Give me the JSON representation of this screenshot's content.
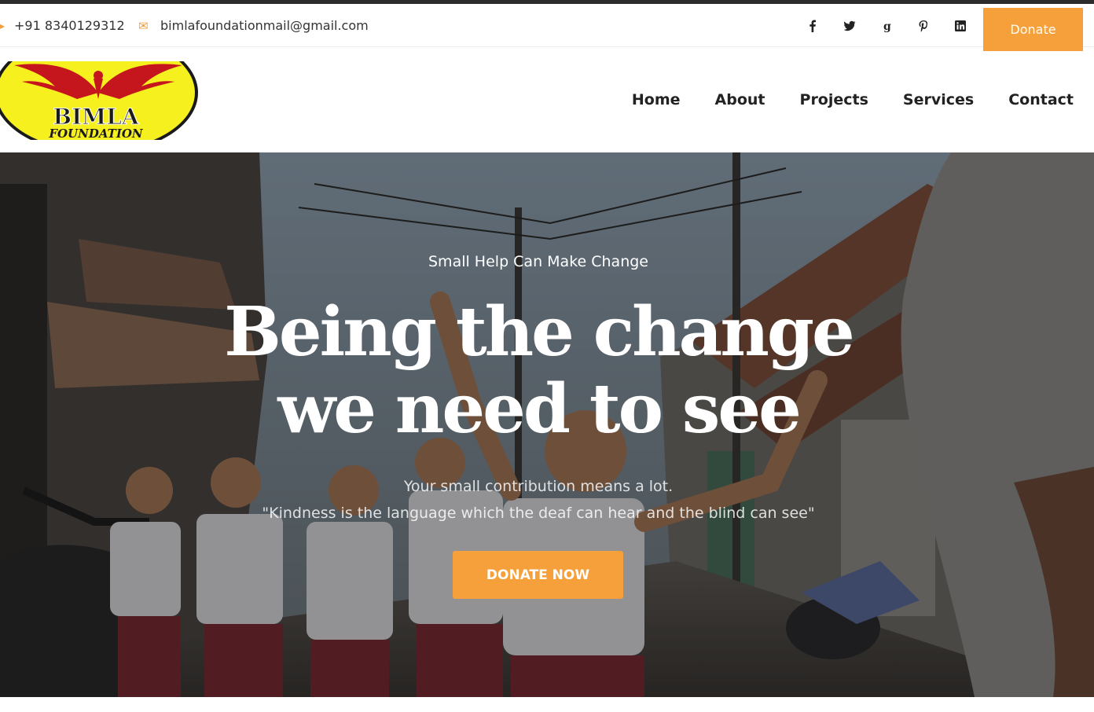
{
  "topbar": {
    "phone": "+91 8340129312",
    "email": "bimlafoundationmail@gmail.com",
    "phone_icon": "phone-icon",
    "email_icon": "envelope-icon",
    "socials": [
      "facebook-icon",
      "twitter-icon",
      "google-icon",
      "pinterest-icon",
      "linkedin-icon"
    ],
    "donate_label": "Donate"
  },
  "logo": {
    "line1": "BIMLA",
    "line2": "FOUNDATION"
  },
  "nav": {
    "items": [
      "Home",
      "About",
      "Projects",
      "Services",
      "Contact"
    ]
  },
  "hero": {
    "tagline": "Small Help Can Make Change",
    "headline_line1": "Being the change",
    "headline_line2": "we need to see",
    "sub1": "Your small contribution means a lot.",
    "sub2": "\"Kindness is the language which the deaf can hear and the blind can see\"",
    "cta_label": "DONATE NOW"
  },
  "colors": {
    "accent": "#f5a03a",
    "logo_yellow": "#f6f01f",
    "logo_red": "#c4161c"
  }
}
